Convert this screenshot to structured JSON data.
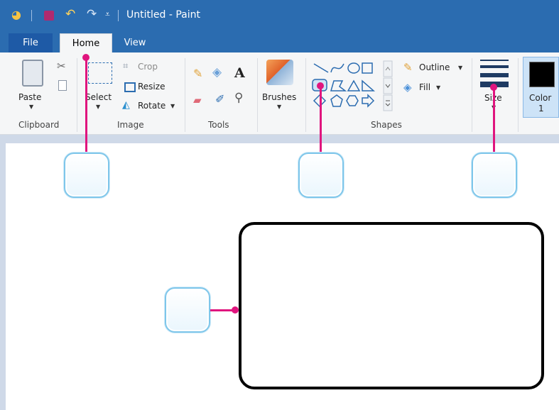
{
  "window": {
    "title": "Untitled - Paint"
  },
  "tabs": {
    "file": "File",
    "home": "Home",
    "view": "View"
  },
  "clipboard": {
    "paste": "Paste",
    "group": "Clipboard"
  },
  "image": {
    "select": "Select",
    "crop": "Crop",
    "resize": "Resize",
    "rotate": "Rotate",
    "group": "Image"
  },
  "tools": {
    "group": "Tools"
  },
  "brushes": {
    "label": "Brushes"
  },
  "shapes": {
    "outline": "Outline",
    "fill": "Fill",
    "group": "Shapes"
  },
  "size": {
    "label": "Size"
  },
  "color1": {
    "label": "Color",
    "index": "1",
    "value": "#000000"
  },
  "colors": {
    "titlebar": "#2b6cb0",
    "callout_line": "#e0157e",
    "callout_border": "#7ec6ea"
  }
}
